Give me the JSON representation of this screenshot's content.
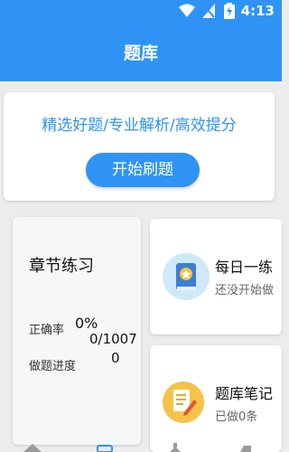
{
  "status_bar": {
    "time": "4:13"
  },
  "app_bar": {
    "title": "题库"
  },
  "banner": {
    "slogan": "精选好题/专业解析/高效提分",
    "start_button": "开始刷题"
  },
  "chapter": {
    "title": "章节练习",
    "accuracy_label": "正确率",
    "accuracy_value": "0%",
    "total_value": "0/1007",
    "progress_label": "做题进度",
    "progress_value": "0"
  },
  "daily": {
    "title": "每日一练",
    "subtitle": "还没开始做"
  },
  "notes": {
    "title": "题库笔记",
    "subtitle": "已做0条"
  },
  "colors": {
    "primary": "#2f93f5",
    "background": "#ececec",
    "card": "#ffffff"
  },
  "icons": [
    "wifi-icon",
    "signal-icon",
    "battery-icon",
    "book-star-icon",
    "notes-pencil-icon"
  ]
}
